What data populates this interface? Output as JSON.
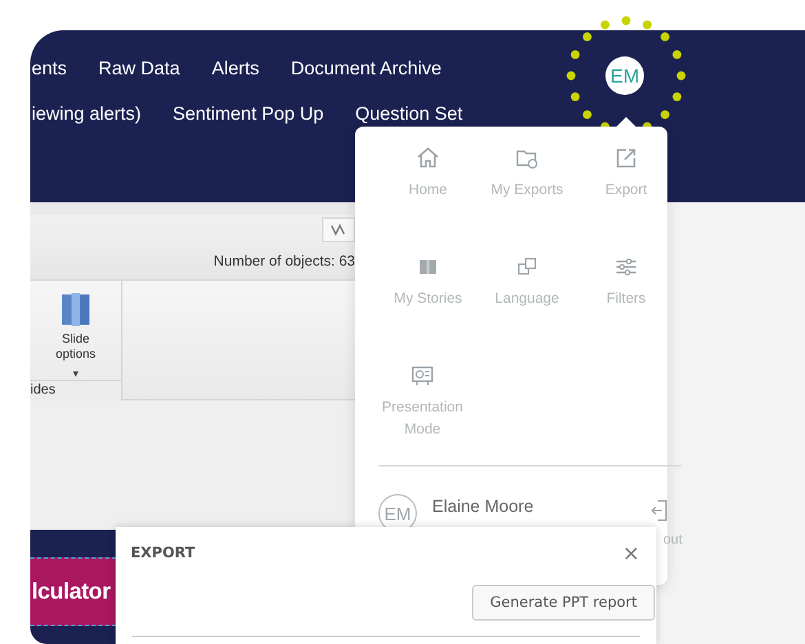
{
  "nav_rows": [
    [
      "ents",
      "Raw Data",
      "Alerts",
      "Document Archive"
    ],
    [
      "iewing alerts)",
      "Sentiment Pop Up",
      "Question Set"
    ]
  ],
  "avatar": {
    "initials": "EM"
  },
  "toolbar": {
    "object_count": "Number of objects: 63"
  },
  "ribbon": {
    "button_label": "Slide options",
    "caret": "▾",
    "group_label": "ides"
  },
  "banner": {
    "text": "lculator"
  },
  "user_menu": {
    "items": [
      {
        "kind": "home",
        "label": "Home"
      },
      {
        "kind": "exports",
        "label": "My Exports"
      },
      {
        "kind": "export",
        "label": "Export"
      },
      {
        "kind": "stories",
        "label": "My Stories"
      },
      {
        "kind": "language",
        "label": "Language"
      },
      {
        "kind": "filters",
        "label": "Filters"
      },
      {
        "kind": "presentation",
        "label": "Presentation Mode"
      }
    ],
    "user": {
      "initials": "EM",
      "name": "Elaine Moore",
      "logout_label": "out"
    }
  },
  "export_dialog": {
    "title": "EXPORT",
    "close": "×",
    "button": "Generate PPT report"
  }
}
